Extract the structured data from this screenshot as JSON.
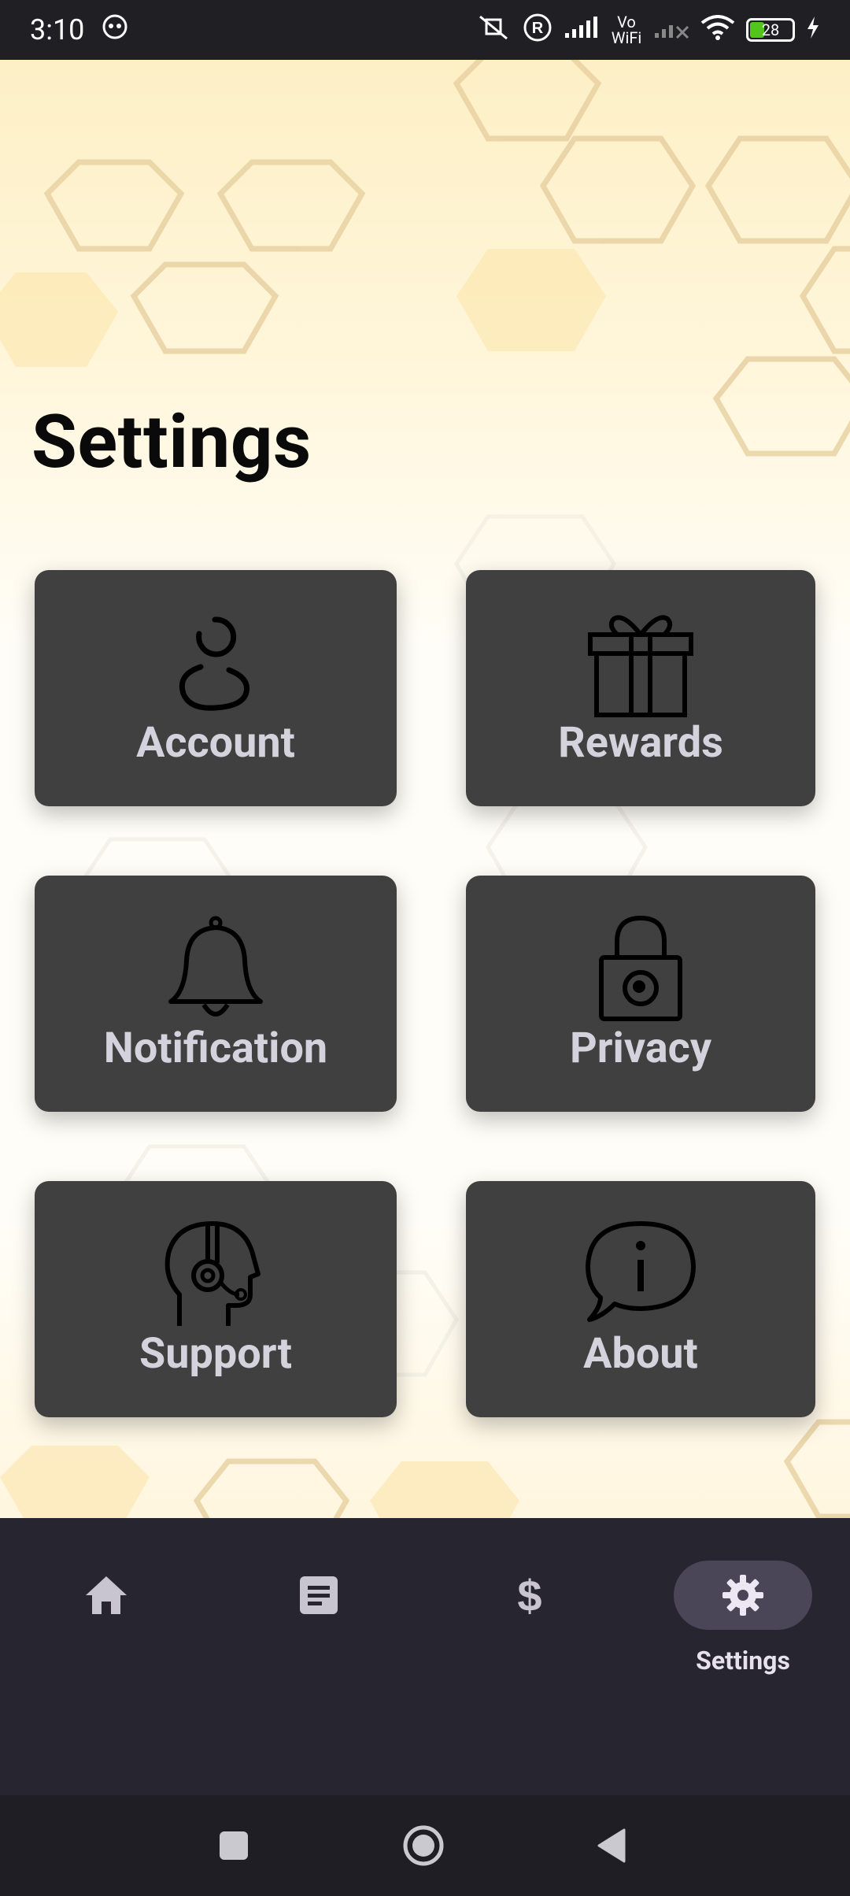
{
  "status_bar": {
    "time": "3:10",
    "network_label": "Vo WiFi",
    "battery_level": "28"
  },
  "page": {
    "title": "Settings"
  },
  "cards": [
    {
      "label": "Account",
      "icon": "account-icon"
    },
    {
      "label": "Rewards",
      "icon": "gift-icon"
    },
    {
      "label": "Notification",
      "icon": "bell-icon"
    },
    {
      "label": "Privacy",
      "icon": "lock-icon"
    },
    {
      "label": "Support",
      "icon": "support-headset-icon"
    },
    {
      "label": "About",
      "icon": "info-bubble-icon"
    }
  ],
  "bottom_nav": {
    "items": [
      {
        "icon": "home-icon",
        "label": ""
      },
      {
        "icon": "document-icon",
        "label": ""
      },
      {
        "icon": "dollar-icon",
        "label": ""
      },
      {
        "icon": "gear-icon",
        "label": "Settings",
        "active": true
      }
    ]
  },
  "colors": {
    "card_bg": "#404040",
    "card_text": "#d4d2dc",
    "nav_bg": "#27252f",
    "active_pill": "#4a4658"
  }
}
